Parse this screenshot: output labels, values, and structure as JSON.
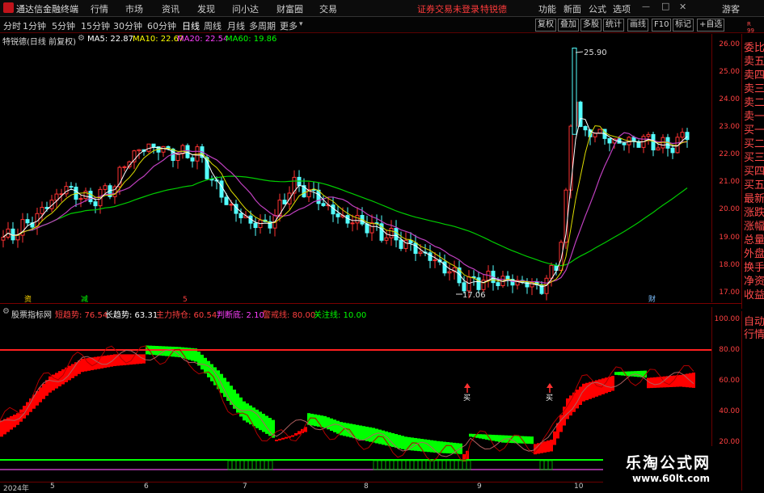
{
  "menubar": {
    "title": "通达信金融终端",
    "items": [
      "行情",
      "市场",
      "资讯",
      "发现",
      "问小达",
      "财富圈",
      "交易"
    ],
    "login": "证券交易未登录",
    "stock": "特锐德",
    "right_items": [
      "功能",
      "新面",
      "公式",
      "选项"
    ],
    "guest": "游客"
  },
  "toolbar": {
    "periods": [
      "分时",
      "1分钟",
      "5分钟",
      "15分钟",
      "30分钟",
      "60分钟",
      "日线",
      "周线",
      "月线",
      "多周期",
      "更多"
    ],
    "active_period": "日线",
    "buttons": [
      "复权",
      "叠加",
      "多股",
      "统计",
      "画线",
      "F10",
      "标记",
      "+自选"
    ]
  },
  "legend1": {
    "name": "特锐德(日线 前复权)",
    "ma5": "MA5: 22.87",
    "ma10": "MA10: 22.67",
    "ma20": "MA20: 22.54",
    "ma60": "MA60: 19.86"
  },
  "price_axis": [
    "26.00",
    "25.00",
    "24.00",
    "23.00",
    "22.00",
    "21.00",
    "20.00",
    "19.00",
    "18.00",
    "17.00"
  ],
  "annotations": {
    "high": "25.90",
    "low": "17.06"
  },
  "markers": {
    "m1": "资",
    "m2": "减",
    "m3": "5",
    "m4": "财"
  },
  "legend2": {
    "name": "股票指标网",
    "short": "短趋势: 76.54",
    "long": "长趋势: 63.31",
    "main": "主力持仓: 60.54",
    "bottom": "判断底: 2.10",
    "alarm": "警戒线: 80.00",
    "focus": "关注线: 10.00"
  },
  "lower_axis": [
    "100.00",
    "80.00",
    "60.00",
    "40.00",
    "20.00"
  ],
  "buy_label": "买",
  "sidepanel": [
    "委比",
    "卖五",
    "卖四",
    "卖三",
    "卖二",
    "卖一",
    "买一",
    "买二",
    "买三",
    "买四",
    "买五",
    "最新",
    "涨跌",
    "涨幅",
    "总量",
    "外盘",
    "换手",
    "净资",
    "收益"
  ],
  "sidepanel_top": "R\n99",
  "sidepanel2": [
    "自动",
    "行情"
  ],
  "xaxis": {
    "year": "2024年",
    "ticks": [
      "5",
      "6",
      "7",
      "8",
      "9",
      "10"
    ]
  },
  "watermark": {
    "line1": "乐淘公式网",
    "line2": "www.60lt.com"
  },
  "colors": {
    "up": "#ff3232",
    "down": "#54ffff",
    "ma5": "#ffffff",
    "ma10": "#ffff00",
    "ma20": "#ff40ff",
    "ma60": "#00ff00",
    "ind_red": "#ff0000",
    "ind_green": "#00ff00"
  }
}
